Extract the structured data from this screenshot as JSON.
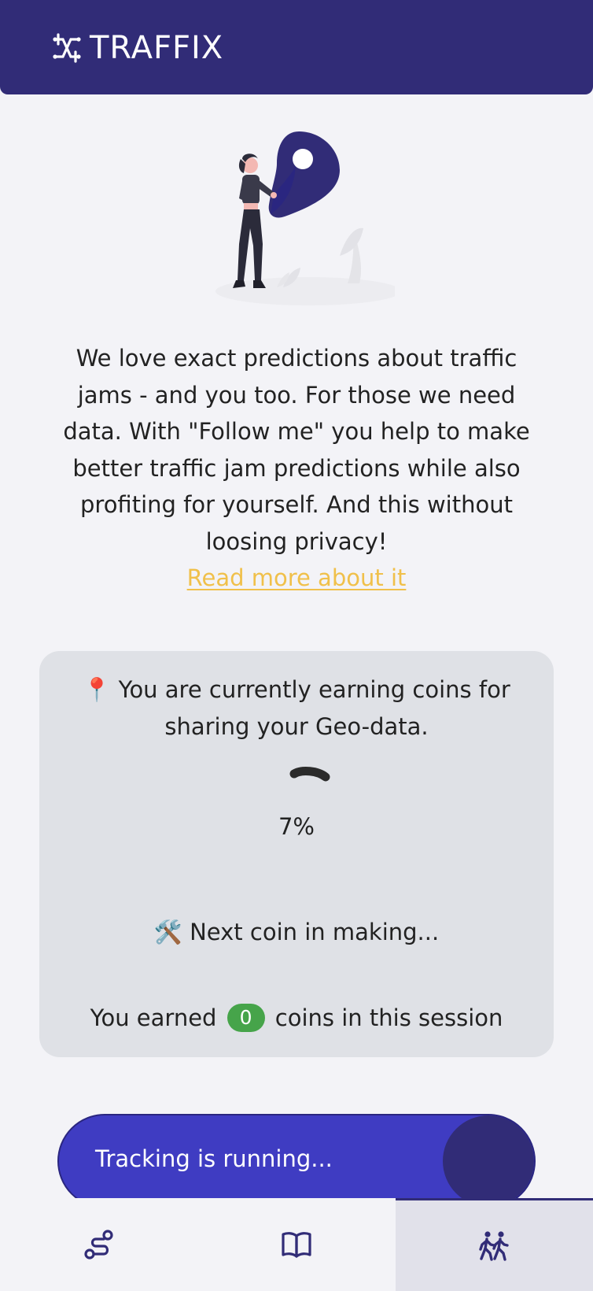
{
  "header": {
    "brand": "TRAFFIX"
  },
  "intro": {
    "text": "We love exact predictions about traffic jams - and you too. For those we need data. With \"Follow me\" you help to make better traffic jam predictions while also profiting for yourself. And this without loosing privacy!",
    "read_more_label": "Read more about it"
  },
  "earnings": {
    "status_emoji": "📍",
    "status_text": "You are currently earning coins for sharing your Geo-data.",
    "progress_label": "7%",
    "progress_value": 0.07,
    "next_coin_emoji": "🛠️",
    "next_coin_text": "Next coin in making...",
    "earned_prefix": "You earned",
    "earned_count": "0",
    "earned_suffix": "coins in this session"
  },
  "tracking": {
    "label": "Tracking is running..."
  },
  "nav": {
    "items": [
      {
        "icon": "route-icon",
        "active": false
      },
      {
        "icon": "book-icon",
        "active": false
      },
      {
        "icon": "walking-people-icon",
        "active": true
      }
    ]
  },
  "colors": {
    "header": "#312c77",
    "accent": "#3f3cc2",
    "link": "#f0c04a",
    "badge": "#46a44a",
    "card": "#dfe1e6"
  }
}
